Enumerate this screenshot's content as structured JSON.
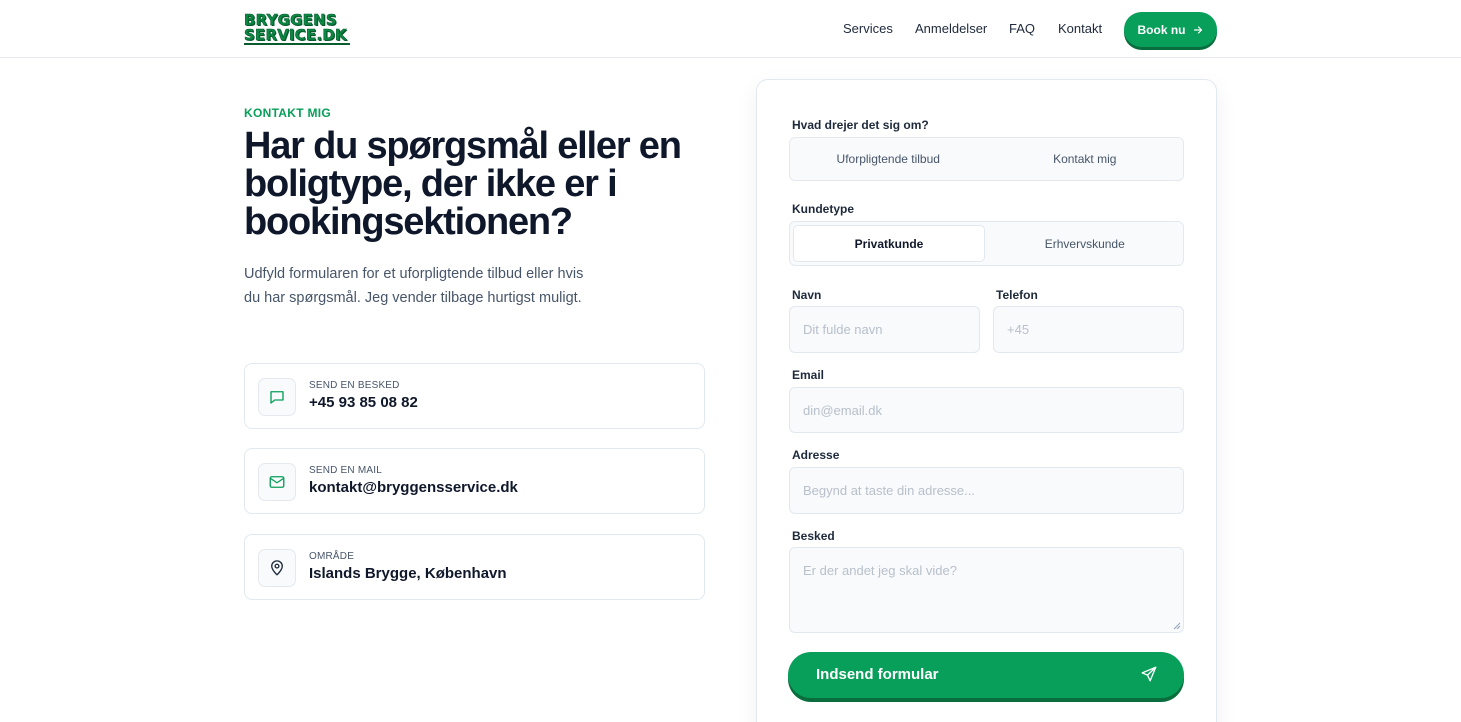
{
  "header": {
    "logo_line1": "BRYGGENS",
    "logo_line2": "SERVICE.DK",
    "nav": [
      "Services",
      "Anmeldelser",
      "FAQ",
      "Kontakt"
    ],
    "book_label": "Book nu"
  },
  "hero": {
    "eyebrow": "KONTAKT MIG",
    "headline": "Har du spørgsmål eller en boligtype, der ikke er i bookingsektionen?",
    "intro": "Udfyld formularen for et uforpligtende tilbud eller hvis du har spørgsmål. Jeg vender tilbage hurtigst muligt."
  },
  "contact_cards": [
    {
      "label": "SEND EN BESKED",
      "value": "+45 93 85 08 82",
      "icon": "message-icon"
    },
    {
      "label": "SEND EN MAIL",
      "value": "kontakt@bryggensservice.dk",
      "icon": "mail-icon"
    },
    {
      "label": "OMRÅDE",
      "value": "Islands Brygge, København",
      "icon": "location-pin-icon"
    }
  ],
  "form": {
    "topic_label": "Hvad drejer det sig om?",
    "topic_options": [
      "Uforpligtende tilbud",
      "Kontakt mig"
    ],
    "customer_label": "Kundetype",
    "customer_options": [
      "Privatkunde",
      "Erhvervskunde"
    ],
    "customer_selected": "Privatkunde",
    "name_label": "Navn",
    "name_placeholder": "Dit fulde navn",
    "phone_label": "Telefon",
    "phone_placeholder": "+45",
    "email_label": "Email",
    "email_placeholder": "din@email.dk",
    "address_label": "Adresse",
    "address_placeholder": "Begynd at taste din adresse...",
    "message_label": "Besked",
    "message_placeholder": "Er der andet jeg skal vide?",
    "submit_label": "Indsend formular"
  },
  "colors": {
    "accent": "#089f5a",
    "accent_shadow": "#0a6d3e",
    "text": "#0f172a",
    "muted": "#475569"
  }
}
